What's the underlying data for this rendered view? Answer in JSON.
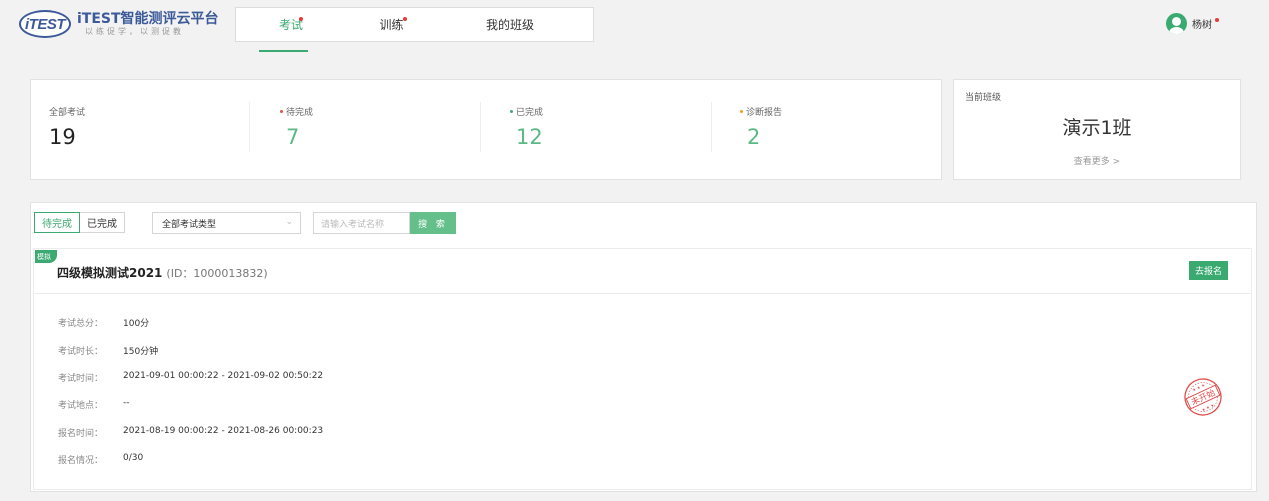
{
  "header": {
    "logo_badge": "iTEST",
    "logo_title": "iTEST智能测评云平台",
    "logo_sub": "以练促学，以测促教",
    "nav": [
      {
        "label": "考试",
        "active": true,
        "dot": true
      },
      {
        "label": "训练",
        "active": false,
        "dot": true
      },
      {
        "label": "我的班级",
        "active": false,
        "dot": false
      }
    ],
    "user_name": "杨树"
  },
  "stats": {
    "all": {
      "label": "全部考试",
      "value": "19"
    },
    "pending": {
      "label": "待完成",
      "value": "7"
    },
    "done": {
      "label": "已完成",
      "value": "12"
    },
    "report": {
      "label": "诊断报告",
      "value": "2"
    }
  },
  "current_class": {
    "label": "当前班级",
    "name": "演示1班",
    "more": "查看更多 >"
  },
  "filters": {
    "tabs": [
      {
        "label": "待完成",
        "active": true
      },
      {
        "label": "已完成",
        "active": false
      }
    ],
    "type_select": "全部考试类型",
    "search_placeholder": "请输入考试名称",
    "search_button": "搜 索"
  },
  "exam": {
    "tag": "模拟",
    "title": "四级模拟测试2021",
    "id_text": "(ID：1000013832)",
    "action": "去报名",
    "stamp_text": "未开始",
    "info": [
      {
        "key": "考试总分：",
        "value": "100分"
      },
      {
        "key": "考试时长：",
        "value": "150分钟"
      },
      {
        "key": "考试时间：",
        "value": "2021-09-01 00:00:22 - 2021-09-02 00:50:22"
      },
      {
        "key": "考试地点：",
        "value": "--"
      },
      {
        "key": "报名时间：",
        "value": "2021-08-19 00:00:22 - 2021-08-26 00:00:23"
      },
      {
        "key": "报名情况：",
        "value": "0/30"
      }
    ]
  },
  "colors": {
    "accent": "#3aaa70",
    "stat_value": "#5cb985",
    "pending_dot": "#e84c4c",
    "done_dot": "#3aaa70",
    "report_dot": "#f0a020",
    "stamp": "#e05050"
  }
}
